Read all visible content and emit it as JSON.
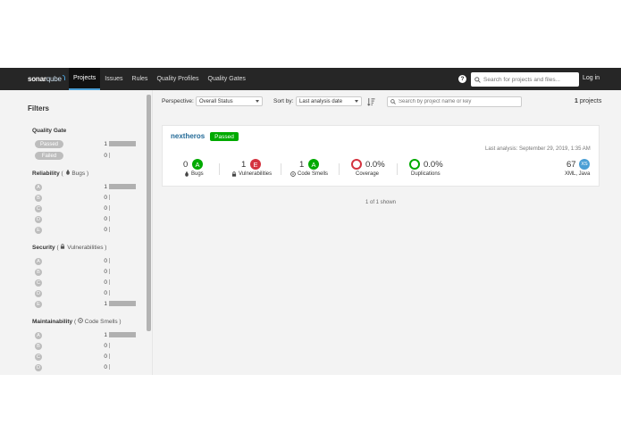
{
  "header": {
    "logo_text": "sonar",
    "logo_text_2": "qube",
    "nav": [
      {
        "label": "Projects",
        "active": true
      },
      {
        "label": "Issues",
        "active": false
      },
      {
        "label": "Rules",
        "active": false
      },
      {
        "label": "Quality Profiles",
        "active": false
      },
      {
        "label": "Quality Gates",
        "active": false
      }
    ],
    "help_glyph": "?",
    "search_placeholder": "Search for projects and files...",
    "login_label": "Log in"
  },
  "sidebar": {
    "title": "Filters",
    "quality_gate": {
      "title": "Quality Gate",
      "rows": [
        {
          "label": "Passed",
          "count": "1",
          "fraction": 1.0
        },
        {
          "label": "Failed",
          "count": "0",
          "fraction": 0.0
        }
      ]
    },
    "reliability": {
      "title": "Reliability",
      "sub": "Bugs",
      "rows": [
        {
          "label": "A",
          "count": "1",
          "fraction": 1.0
        },
        {
          "label": "B",
          "count": "0",
          "fraction": 0.0
        },
        {
          "label": "C",
          "count": "0",
          "fraction": 0.0
        },
        {
          "label": "D",
          "count": "0",
          "fraction": 0.0
        },
        {
          "label": "E",
          "count": "0",
          "fraction": 0.0
        }
      ]
    },
    "security": {
      "title": "Security",
      "sub": "Vulnerabilities",
      "rows": [
        {
          "label": "A",
          "count": "0",
          "fraction": 0.0
        },
        {
          "label": "B",
          "count": "0",
          "fraction": 0.0
        },
        {
          "label": "C",
          "count": "0",
          "fraction": 0.0
        },
        {
          "label": "D",
          "count": "0",
          "fraction": 0.0
        },
        {
          "label": "E",
          "count": "1",
          "fraction": 1.0
        }
      ]
    },
    "maintainability": {
      "title": "Maintainability",
      "sub": "Code Smells",
      "rows": [
        {
          "label": "A",
          "count": "1",
          "fraction": 1.0
        },
        {
          "label": "B",
          "count": "0",
          "fraction": 0.0
        },
        {
          "label": "C",
          "count": "0",
          "fraction": 0.0
        },
        {
          "label": "D",
          "count": "0",
          "fraction": 0.0
        }
      ]
    }
  },
  "toolbar": {
    "perspective_label": "Perspective:",
    "perspective_value": "Overall Status",
    "sort_label": "Sort by:",
    "sort_value": "Last analysis date",
    "search_placeholder": "Search by project name or key",
    "count": "1",
    "count_suffix": "projects"
  },
  "project": {
    "name": "nextheros",
    "gate": "Passed",
    "last_analysis": "Last analysis: September 29, 2019, 1:35 AM",
    "bugs": {
      "value": "0",
      "rating": "A",
      "label": "Bugs"
    },
    "vulnerabilities": {
      "value": "1",
      "rating": "E",
      "label": "Vulnerabilities"
    },
    "code_smells": {
      "value": "1",
      "rating": "A",
      "label": "Code Smells"
    },
    "coverage": {
      "value": "0.0%",
      "label": "Coverage"
    },
    "duplications": {
      "value": "0.0%",
      "label": "Duplications"
    },
    "size": {
      "value": "67",
      "badge": "XS",
      "languages": "XML, Java"
    }
  },
  "footer": {
    "shown": "1 of 1 shown"
  },
  "colors": {
    "rating_a": "#00aa00",
    "rating_e": "#d4333f",
    "coverage_ring": "#d4333f",
    "duplication_ring": "#00aa00",
    "accent": "#4b9fd5"
  }
}
